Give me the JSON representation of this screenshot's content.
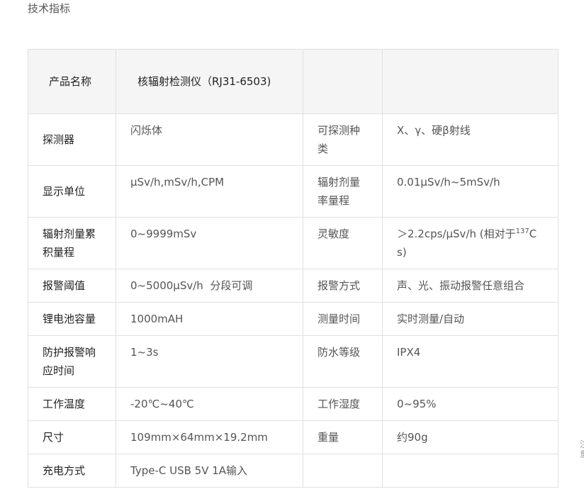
{
  "section_title": "技术指标",
  "header": {
    "product_name_label": "产品名称",
    "product_name_value": "核辐射检测仪（RJ31-6503)"
  },
  "rows": [
    {
      "l1": "探测器",
      "v1": "闪烁体",
      "l2": "可探测种类",
      "v2": "X、γ、硬β射线"
    },
    {
      "l1": "显示单位",
      "v1": "μSv/h,mSv/h,CPM",
      "l2": "辐射剂量率量程",
      "v2": "0.01μSv/h~5mSv/h"
    },
    {
      "l1": "辐射剂量累积量程",
      "v1": "0~9999mSv",
      "l2": "灵敏度",
      "v2_pre": "＞2.2cps/μSv/h (相对于",
      "v2_sup": "137",
      "v2_post": "Cs)"
    },
    {
      "l1": "报警阈值",
      "v1": "0~5000μSv/h  分段可调",
      "l2": "报警方式",
      "v2": "声、光、振动报警任意组合"
    },
    {
      "l1": "锂电池容量",
      "v1": "1000mAH",
      "l2": "测量时间",
      "v2": "实时测量/自动"
    },
    {
      "l1": "防护报警响应时间",
      "v1": "1~3s",
      "l2": "防水等级",
      "v2": "IPX4"
    },
    {
      "l1": "工作温度",
      "v1": "-20℃~40℃",
      "l2": "工作湿度",
      "v2": "0~95%"
    },
    {
      "l1": "尺寸",
      "v1": "109mm×64mm×19.2mm",
      "l2": "重量",
      "v2": "约90g"
    },
    {
      "l1": "充电方式",
      "v1": "Type-C USB 5V 1A输入",
      "l2": "",
      "v2": ""
    }
  ],
  "edge_text": "注意"
}
